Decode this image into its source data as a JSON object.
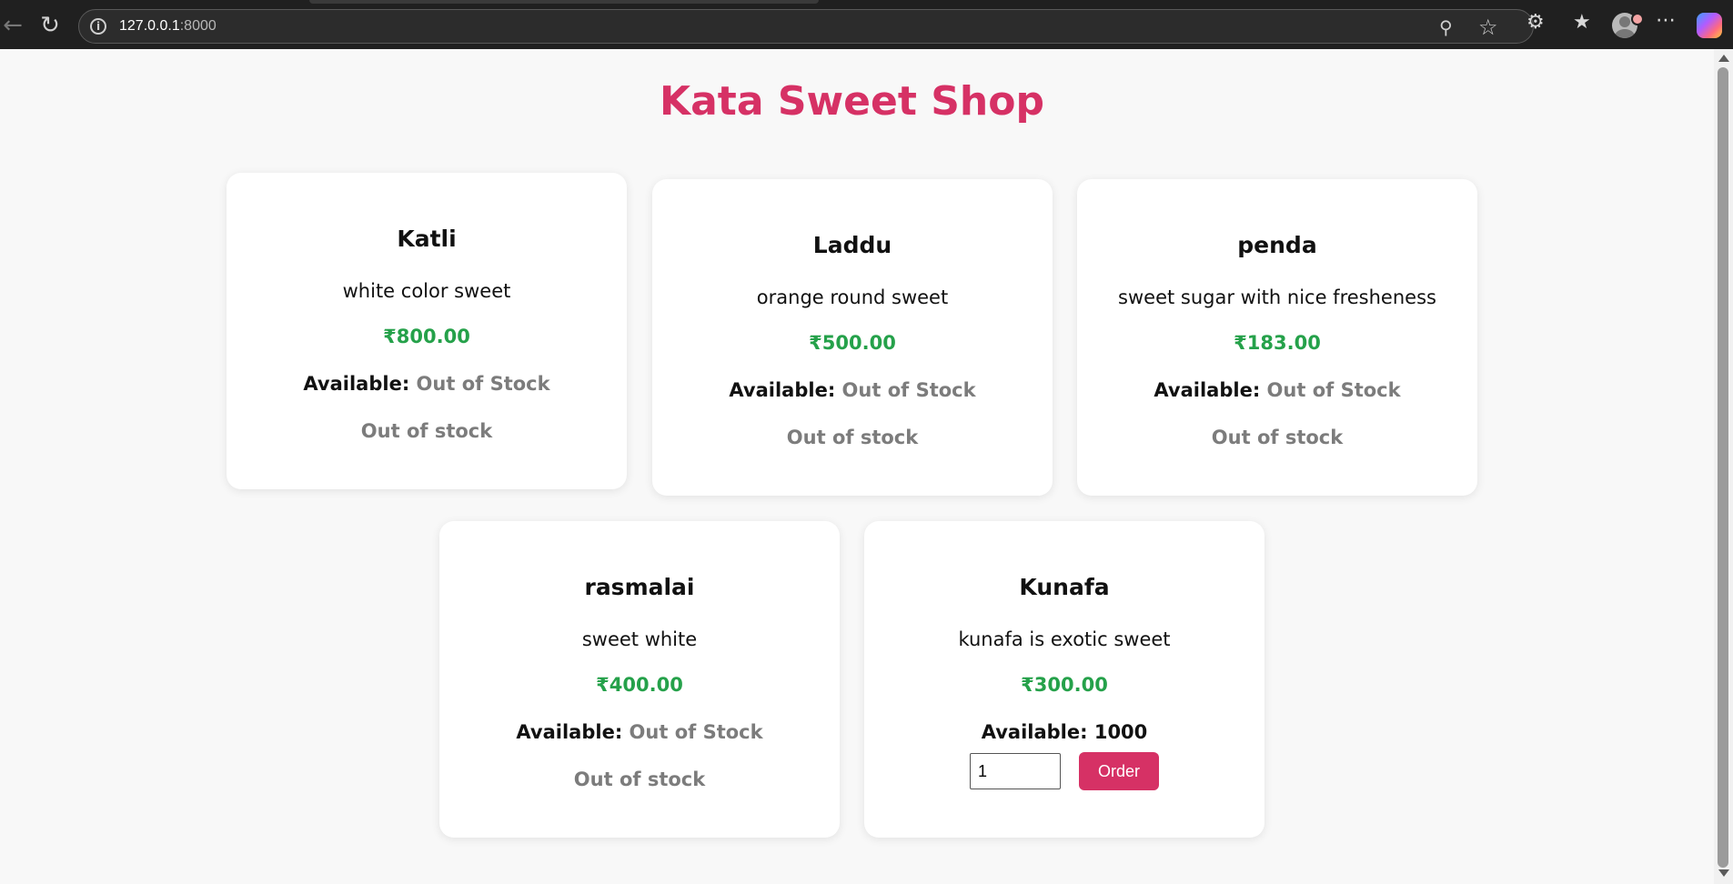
{
  "browser": {
    "url_host": "127.0.0.1",
    "url_port": ":8000",
    "icons": [
      "back-icon",
      "reload-icon",
      "site-info-icon",
      "zoom-icon",
      "favorite-star-icon",
      "extensions-icon",
      "favorites-icon",
      "profile-icon",
      "more-icon",
      "copilot-icon"
    ]
  },
  "page": {
    "title": "Kata Sweet Shop",
    "available_label": "Available:",
    "colors": {
      "accent": "#d63165",
      "price": "#25a14a",
      "muted": "#7c7c7c"
    }
  },
  "sweets": [
    {
      "name": "Katli",
      "description": "white color sweet",
      "price": "₹800.00",
      "available": "Out of Stock",
      "status": "Out of stock"
    },
    {
      "name": "Laddu",
      "description": "orange round sweet",
      "price": "₹500.00",
      "available": "Out of Stock",
      "status": "Out of stock"
    },
    {
      "name": "penda",
      "description": "sweet sugar with nice fresheness",
      "price": "₹183.00",
      "available": "Out of Stock",
      "status": "Out of stock"
    },
    {
      "name": "rasmalai",
      "description": "sweet white",
      "price": "₹400.00",
      "available": "Out of Stock",
      "status": "Out of stock"
    },
    {
      "name": "Kunafa",
      "description": "kunafa is exotic sweet",
      "price": "₹300.00",
      "available": "1000",
      "quantity_value": "1",
      "order_label": "Order"
    }
  ]
}
